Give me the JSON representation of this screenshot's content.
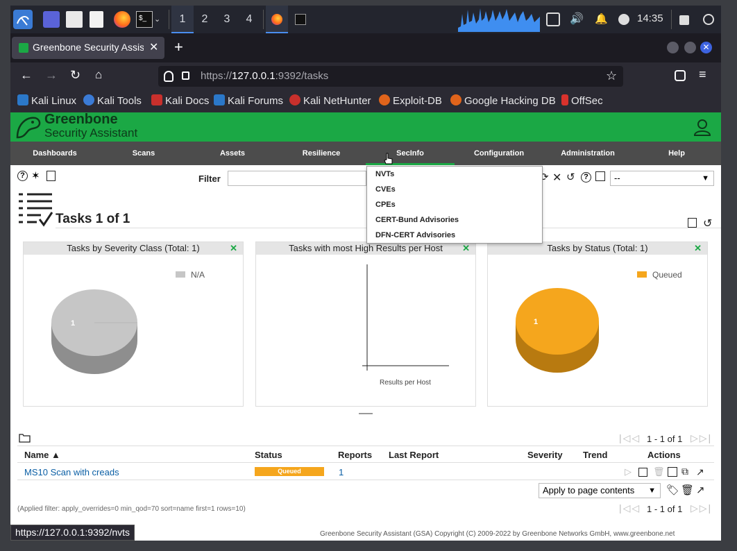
{
  "taskbar": {
    "workspaces": [
      "1",
      "2",
      "3",
      "4"
    ],
    "clock": "14:35"
  },
  "browser": {
    "tab_title": "Greenbone Security Assist",
    "url_prefix": "https://",
    "url_host": "127.0.0.1",
    "url_rest": ":9392/tasks",
    "bookmarks": [
      {
        "label": "Kali Linux",
        "color": "#2b78c9"
      },
      {
        "label": "Kali Tools",
        "color": "#3b7bd6"
      },
      {
        "label": "Kali Docs",
        "color": "#c9302c"
      },
      {
        "label": "Kali Forums",
        "color": "#2b78c9"
      },
      {
        "label": "Kali NetHunter",
        "color": "#c9302c"
      },
      {
        "label": "Exploit-DB",
        "color": "#e0641b"
      },
      {
        "label": "Google Hacking DB",
        "color": "#e0641b"
      },
      {
        "label": "OffSec",
        "color": "#d9322c"
      }
    ]
  },
  "gsa": {
    "brand_line1": "Greenbone",
    "brand_line2": "Security Assistant",
    "menu": [
      "Dashboards",
      "Scans",
      "Assets",
      "Resilience",
      "SecInfo",
      "Configuration",
      "Administration",
      "Help"
    ],
    "secinfo_menu": [
      "NVTs",
      "CVEs",
      "CPEs",
      "CERT-Bund Advisories",
      "DFN-CERT Advisories"
    ],
    "filter_label": "Filter",
    "filter_select": "--",
    "page_title": "Tasks 1 of 1",
    "panels": [
      {
        "title": "Tasks by Severity Class (Total: 1)",
        "legend": "N/A",
        "value": "1",
        "color": "#c6c6c6"
      },
      {
        "title": "Tasks with most High Results per Host",
        "xlabel": "Results per Host"
      },
      {
        "title": "Tasks by Status (Total: 1)",
        "legend": "Queued",
        "value": "1",
        "color": "#f5a61d"
      }
    ],
    "pagination": "1 - 1 of 1",
    "table": {
      "headers": [
        "Name ▲",
        "Status",
        "Reports",
        "Last Report",
        "Severity",
        "Trend",
        "Actions"
      ],
      "rows": [
        {
          "name": "MS10 Scan with creads",
          "status": "Queued",
          "reports": "1",
          "last_report": "",
          "severity": "",
          "trend": ""
        }
      ]
    },
    "bulk_select": "Apply to page contents",
    "applied_filter": "(Applied filter: apply_overrides=0 min_qod=70 sort=name first=1 rows=10)",
    "footer": "Greenbone Security Assistant (GSA) Copyright (C) 2009-2022 by Greenbone Networks GmbH, www.greenbone.net"
  },
  "statusbar_url": "https://127.0.0.1:9392/nvts",
  "colors": {
    "green": "#1ba845",
    "menu": "#4c4c4c",
    "queued": "#f5a61d",
    "link": "#0b5fa5"
  }
}
